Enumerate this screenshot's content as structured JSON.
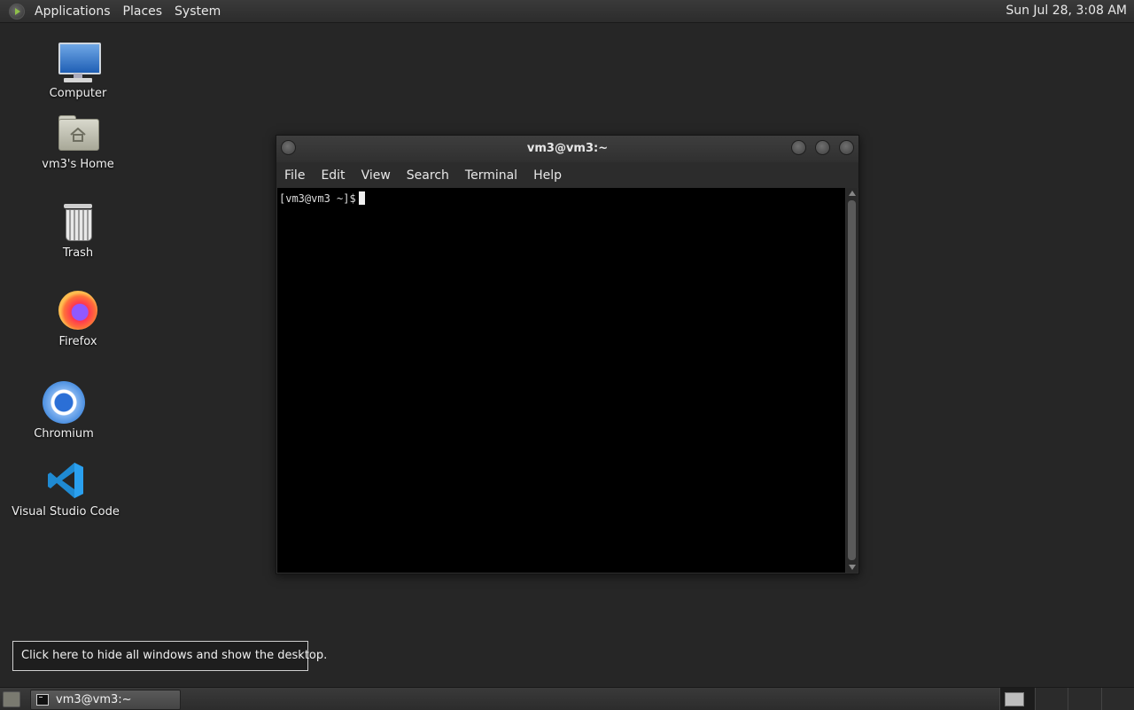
{
  "top_panel": {
    "menus": [
      "Applications",
      "Places",
      "System"
    ],
    "clock": "Sun Jul 28,  3:08 AM"
  },
  "desktop_icons": [
    {
      "label": "Computer",
      "icon": "computer-icon"
    },
    {
      "label": "vm3's Home",
      "icon": "home-folder-icon"
    },
    {
      "label": "Trash",
      "icon": "trash-icon"
    },
    {
      "label": "Firefox",
      "icon": "firefox-icon"
    },
    {
      "label": "Chromium",
      "icon": "chromium-icon"
    },
    {
      "label": "Visual Studio Code",
      "icon": "vscode-icon"
    }
  ],
  "terminal": {
    "title": "vm3@vm3:~",
    "menus": [
      "File",
      "Edit",
      "View",
      "Search",
      "Terminal",
      "Help"
    ],
    "prompt": "[vm3@vm3 ~]$"
  },
  "tooltip": "Click here to hide all windows and show the desktop.",
  "taskbar": {
    "tasks": [
      {
        "label": "vm3@vm3:~",
        "icon": "terminal-icon"
      }
    ]
  },
  "colors": {
    "desktop_bg": "#262626",
    "panel_bg": "#333333",
    "terminal_bg": "#000000"
  }
}
